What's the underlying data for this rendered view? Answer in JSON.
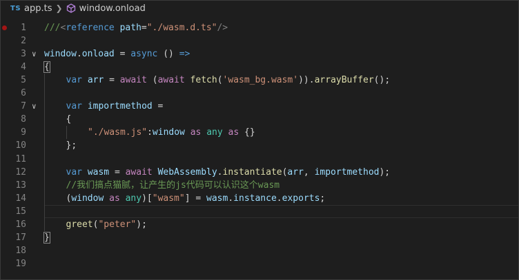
{
  "breadcrumb": {
    "lang_badge": "TS",
    "file": "app.ts",
    "symbol": "window.onload"
  },
  "colors": {
    "background": "#1e1e1e",
    "keyword": "#569cd6",
    "control": "#c586c0",
    "variable": "#9cdcfe",
    "function": "#dcdcaa",
    "string": "#ce9178",
    "type": "#4ec9b0",
    "comment": "#6a9955",
    "breakpoint": "#a31515"
  },
  "lines": [
    {
      "n": "1",
      "breakpoint": true,
      "fold": false,
      "indent": 0,
      "tokens": [
        {
          "t": "///",
          "c": "g"
        },
        {
          "t": "<",
          "c": "m"
        },
        {
          "t": "reference",
          "c": "k"
        },
        {
          "t": " ",
          "c": "p"
        },
        {
          "t": "path",
          "c": "v"
        },
        {
          "t": "=",
          "c": "p"
        },
        {
          "t": "\"./wasm.d.ts\"",
          "c": "s"
        },
        {
          "t": "/>",
          "c": "m"
        }
      ]
    },
    {
      "n": "2",
      "tokens": []
    },
    {
      "n": "3",
      "fold": true,
      "indent": 0,
      "tokens": [
        {
          "t": "window",
          "c": "v"
        },
        {
          "t": ".",
          "c": "p"
        },
        {
          "t": "onload",
          "c": "v"
        },
        {
          "t": " = ",
          "c": "p"
        },
        {
          "t": "async",
          "c": "k"
        },
        {
          "t": " () ",
          "c": "p"
        },
        {
          "t": "=>",
          "c": "k"
        }
      ]
    },
    {
      "n": "4",
      "indent": 0,
      "tokens": [
        {
          "t": "{",
          "c": "p",
          "hl": true
        }
      ]
    },
    {
      "n": "5",
      "indent": 1,
      "tokens": [
        {
          "t": "var",
          "c": "k"
        },
        {
          "t": " ",
          "c": "p"
        },
        {
          "t": "arr",
          "c": "v"
        },
        {
          "t": " = ",
          "c": "p"
        },
        {
          "t": "await",
          "c": "c"
        },
        {
          "t": " (",
          "c": "p"
        },
        {
          "t": "await",
          "c": "c"
        },
        {
          "t": " ",
          "c": "p"
        },
        {
          "t": "fetch",
          "c": "f"
        },
        {
          "t": "(",
          "c": "p"
        },
        {
          "t": "'wasm_bg.wasm'",
          "c": "s"
        },
        {
          "t": ")).",
          "c": "p"
        },
        {
          "t": "arrayBuffer",
          "c": "f"
        },
        {
          "t": "();",
          "c": "p"
        }
      ]
    },
    {
      "n": "6",
      "tokens": []
    },
    {
      "n": "7",
      "fold": true,
      "indent": 1,
      "tokens": [
        {
          "t": "var",
          "c": "k"
        },
        {
          "t": " ",
          "c": "p"
        },
        {
          "t": "importmethod",
          "c": "v"
        },
        {
          "t": " =",
          "c": "p"
        }
      ]
    },
    {
      "n": "8",
      "indent": 1,
      "tokens": [
        {
          "t": "{",
          "c": "p"
        }
      ]
    },
    {
      "n": "9",
      "indent": 2,
      "tokens": [
        {
          "t": "\"./wasm.js\"",
          "c": "s"
        },
        {
          "t": ":",
          "c": "p"
        },
        {
          "t": "window",
          "c": "v"
        },
        {
          "t": " ",
          "c": "p"
        },
        {
          "t": "as",
          "c": "c"
        },
        {
          "t": " ",
          "c": "p"
        },
        {
          "t": "any",
          "c": "t"
        },
        {
          "t": " ",
          "c": "p"
        },
        {
          "t": "as",
          "c": "c"
        },
        {
          "t": " {}",
          "c": "p"
        }
      ]
    },
    {
      "n": "10",
      "indent": 1,
      "tokens": [
        {
          "t": "};",
          "c": "p"
        }
      ]
    },
    {
      "n": "11",
      "tokens": []
    },
    {
      "n": "12",
      "indent": 1,
      "tokens": [
        {
          "t": "var",
          "c": "k"
        },
        {
          "t": " ",
          "c": "p"
        },
        {
          "t": "wasm",
          "c": "v"
        },
        {
          "t": " = ",
          "c": "p"
        },
        {
          "t": "await",
          "c": "c"
        },
        {
          "t": " ",
          "c": "p"
        },
        {
          "t": "WebAssembly",
          "c": "v"
        },
        {
          "t": ".",
          "c": "p"
        },
        {
          "t": "instantiate",
          "c": "f"
        },
        {
          "t": "(",
          "c": "p"
        },
        {
          "t": "arr",
          "c": "v"
        },
        {
          "t": ", ",
          "c": "p"
        },
        {
          "t": "importmethod",
          "c": "v"
        },
        {
          "t": ");",
          "c": "p"
        }
      ]
    },
    {
      "n": "13",
      "indent": 1,
      "tokens": [
        {
          "t": "//我们搞点猫腻，让产生的js代码可以认识这个wasm",
          "c": "g"
        }
      ]
    },
    {
      "n": "14",
      "indent": 1,
      "tokens": [
        {
          "t": "(",
          "c": "p"
        },
        {
          "t": "window",
          "c": "v"
        },
        {
          "t": " ",
          "c": "p"
        },
        {
          "t": "as",
          "c": "c"
        },
        {
          "t": " ",
          "c": "p"
        },
        {
          "t": "any",
          "c": "t"
        },
        {
          "t": ")[",
          "c": "p"
        },
        {
          "t": "\"wasm\"",
          "c": "s"
        },
        {
          "t": "] = ",
          "c": "p"
        },
        {
          "t": "wasm",
          "c": "v"
        },
        {
          "t": ".",
          "c": "p"
        },
        {
          "t": "instance",
          "c": "v"
        },
        {
          "t": ".",
          "c": "p"
        },
        {
          "t": "exports",
          "c": "v"
        },
        {
          "t": ";",
          "c": "p"
        }
      ]
    },
    {
      "n": "15",
      "current": true,
      "tokens": []
    },
    {
      "n": "16",
      "indent": 1,
      "tokens": [
        {
          "t": "greet",
          "c": "f"
        },
        {
          "t": "(",
          "c": "p"
        },
        {
          "t": "\"peter\"",
          "c": "s"
        },
        {
          "t": ");",
          "c": "p"
        }
      ]
    },
    {
      "n": "17",
      "indent": 0,
      "tokens": [
        {
          "t": "}",
          "c": "p",
          "hl": true
        }
      ]
    },
    {
      "n": "18",
      "tokens": []
    },
    {
      "n": "19",
      "tokens": []
    }
  ]
}
